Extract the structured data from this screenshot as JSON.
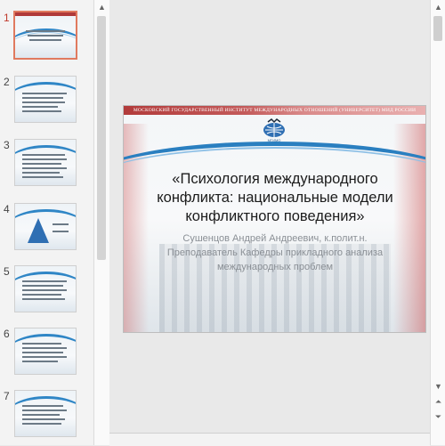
{
  "thumbnails": [
    {
      "number": "1",
      "active": true
    },
    {
      "number": "2",
      "active": false
    },
    {
      "number": "3",
      "active": false
    },
    {
      "number": "4",
      "active": false
    },
    {
      "number": "5",
      "active": false
    },
    {
      "number": "6",
      "active": false
    },
    {
      "number": "7",
      "active": false
    }
  ],
  "slide": {
    "institute": "МОСКОВСКИЙ ГОСУДАРСТВЕННЫЙ ИНСТИТУТ МЕЖДУНАРОДНЫХ ОТНОШЕНИЙ (УНИВЕРСИТЕТ) МИД РОССИИ",
    "logo_text": "МГИМО",
    "title": "«Психология международного конфликта: национальные модели конфликтного поведения»",
    "author": "Сушенцов Андрей Андреевич, к.полит.н. Преподаватель Кафедры прикладного анализа международных проблем"
  },
  "scrollbar": {
    "up_icon": "arrow-up-icon",
    "down_icon": "arrow-down-icon",
    "prev_slide_icon": "double-up-icon",
    "next_slide_icon": "double-down-icon"
  },
  "colors": {
    "active_thumb_border": "#e07a5f",
    "active_number": "#c0392b",
    "swoosh": "#2a7fc0",
    "top_bar": "#b23b3b"
  }
}
